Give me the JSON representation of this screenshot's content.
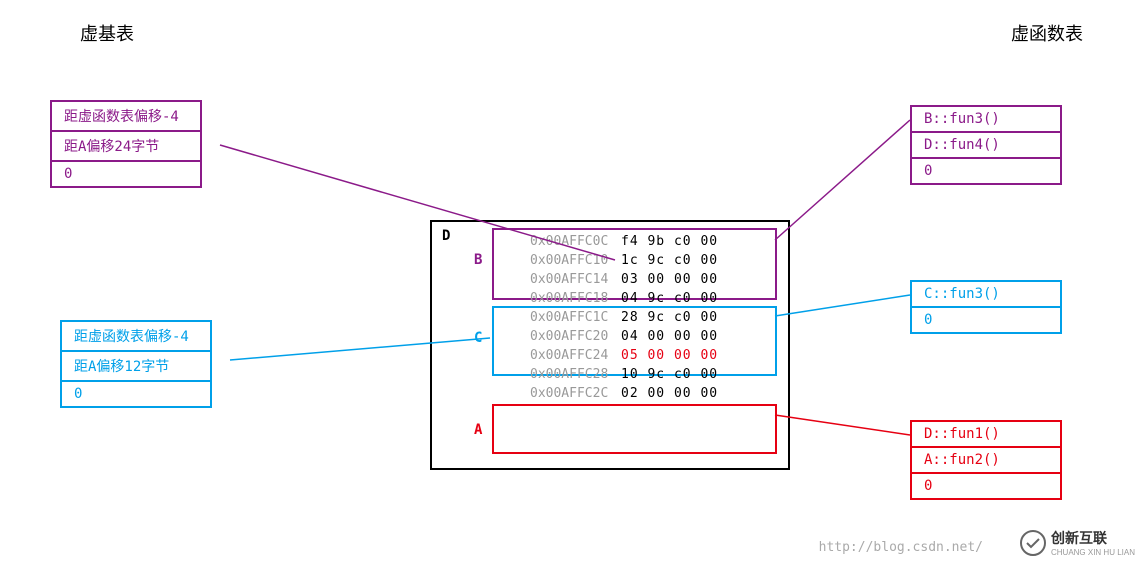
{
  "titles": {
    "left": "虚基表",
    "right": "虚函数表"
  },
  "vbtables": {
    "purple": {
      "row1": "距虚函数表偏移-4",
      "row2": "距A偏移24字节",
      "row3": "0"
    },
    "cyan": {
      "row1": "距虚函数表偏移-4",
      "row2": "距A偏移12字节",
      "row3": "0"
    }
  },
  "vftables": {
    "purple": {
      "row1": "B::fun3()",
      "row2": "D::fun4()",
      "row3": "0"
    },
    "cyan": {
      "row1": "C::fun3()",
      "row2": "0"
    },
    "red": {
      "row1": "D::fun1()",
      "row2": "A::fun2()",
      "row3": "0"
    }
  },
  "memory": {
    "labels": {
      "D": "D",
      "B": "B",
      "C": "C",
      "A": "A"
    },
    "rows": [
      {
        "addr": "0x00AFFC0C",
        "bytes": "f4 9b c0 00",
        "style": ""
      },
      {
        "addr": "0x00AFFC10",
        "bytes": "1c 9c c0 00",
        "style": ""
      },
      {
        "addr": "0x00AFFC14",
        "bytes": "03 00 00 00",
        "style": ""
      },
      {
        "addr": "0x00AFFC18",
        "bytes": "04 9c c0 00",
        "style": ""
      },
      {
        "addr": "0x00AFFC1C",
        "bytes": "28 9c c0 00",
        "style": ""
      },
      {
        "addr": "0x00AFFC20",
        "bytes": "04 00 00 00",
        "style": ""
      },
      {
        "addr": "0x00AFFC24",
        "bytes": "05 00 00 00",
        "style": "red"
      },
      {
        "addr": "0x00AFFC28",
        "bytes": "10 9c c0 00",
        "style": ""
      },
      {
        "addr": "0x00AFFC2C",
        "bytes": "02 00 00 00",
        "style": ""
      }
    ]
  },
  "footer": {
    "url": "http://blog.csdn.net/",
    "logo_text": "创新互联",
    "logo_sub": "CHUANG XIN HU LIAN"
  }
}
